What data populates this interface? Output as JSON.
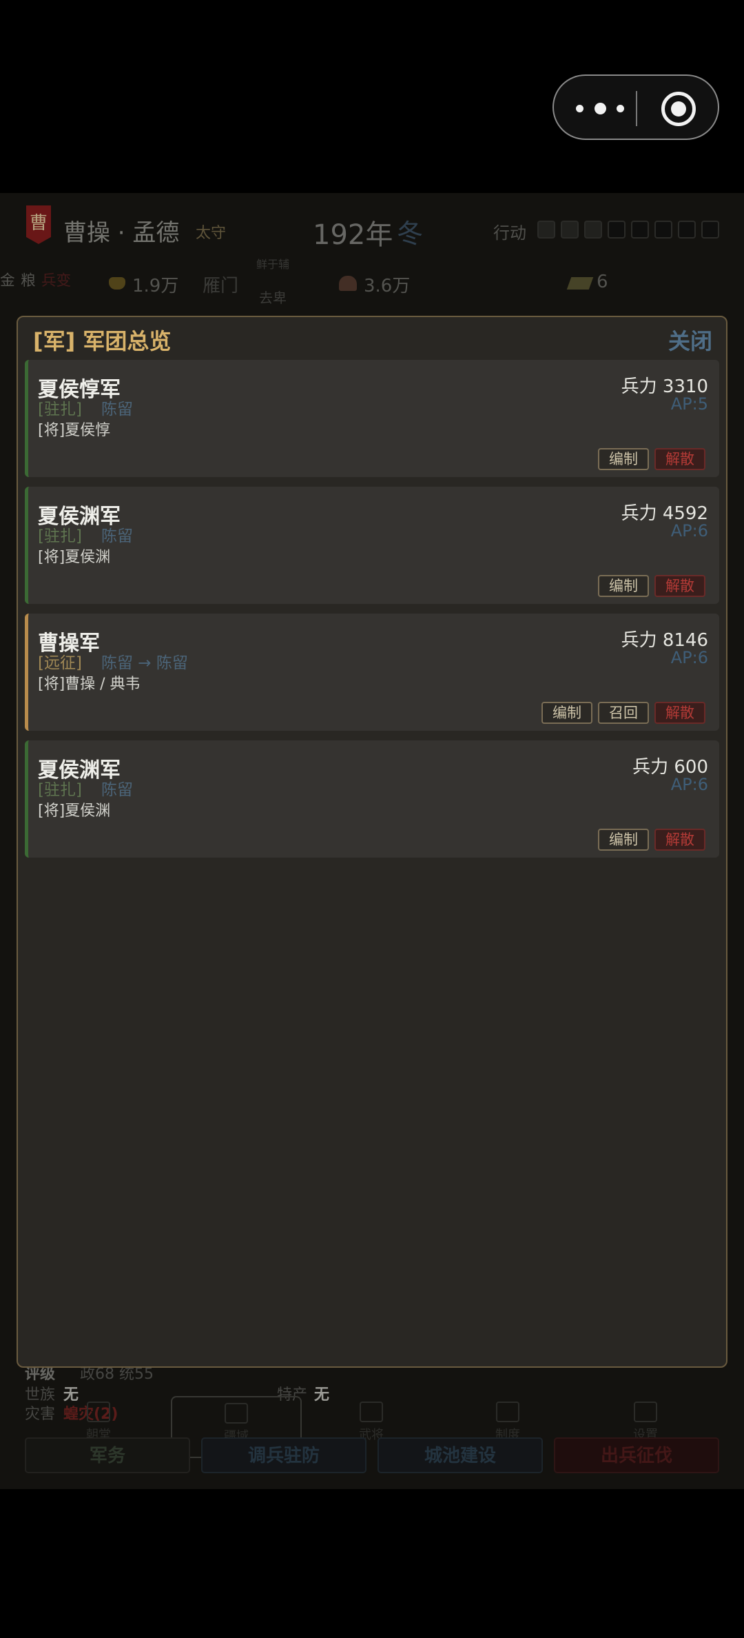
{
  "header": {
    "ruler_name": "曹操 · 孟德",
    "ruler_title": "太守",
    "banner_char": "曹",
    "year": "192年",
    "season": "冬",
    "action_label": "行动",
    "action_total": 8,
    "action_filled": 3
  },
  "resources": {
    "gold": "1.9万",
    "gold_sub": "金",
    "city": "雁门",
    "district_top": "鲜于辅",
    "district": "去卑",
    "grain": "3.6万",
    "grain_sub": "粮",
    "troop": "6",
    "troop_sub": "兵变"
  },
  "modal": {
    "title": "[军] 军团总览",
    "close_label": "关闭",
    "armies": [
      {
        "name": "夏侯惇军",
        "status": "[驻扎]",
        "location": "陈留",
        "generals": "[将]夏侯惇",
        "troops": "兵力 3310",
        "ap": "AP:5",
        "edit_label": "编制",
        "disband_label": "解散"
      },
      {
        "name": "夏侯渊军",
        "status": "[驻扎]",
        "location": "陈留",
        "generals": "[将]夏侯渊",
        "troops": "兵力 4592",
        "ap": "AP:6",
        "edit_label": "编制",
        "disband_label": "解散"
      },
      {
        "name": "曹操军",
        "status": "[远征]",
        "location": "陈留 → 陈留",
        "generals": "[将]曹操 / 典韦",
        "troops": "兵力 8146",
        "ap": "AP:6",
        "edit_label": "编制",
        "recall_label": "召回",
        "disband_label": "解散"
      },
      {
        "name": "夏侯渊军",
        "status": "[驻扎]",
        "location": "陈留",
        "generals": "[将]夏侯渊",
        "troops": "兵力 600",
        "ap": "AP:6",
        "edit_label": "编制",
        "disband_label": "解散"
      }
    ]
  },
  "bottom_info": {
    "label_1": "评级",
    "value_1": "政68 统55",
    "gentry_label": "世族",
    "gentry_value": "无",
    "specialty_label": "特产",
    "specialty_value": "无",
    "disaster_label": "灾害",
    "disaster_value": "蝗灾(2)"
  },
  "bg_nav": [
    "朝堂",
    "疆域",
    "武将",
    "制度",
    "设置"
  ],
  "bg_actions": [
    "军务",
    "调兵驻防",
    "城池建设",
    "出兵征伐"
  ],
  "colors": {
    "modal_bg": "#292723",
    "title_gold": "#d9b36a",
    "close_blue": "#4f6e88",
    "garrison_green": "#5f7550",
    "expedition_gold": "#a08855",
    "location_blue": "#4b6478",
    "danger_red": "#b23a36"
  }
}
